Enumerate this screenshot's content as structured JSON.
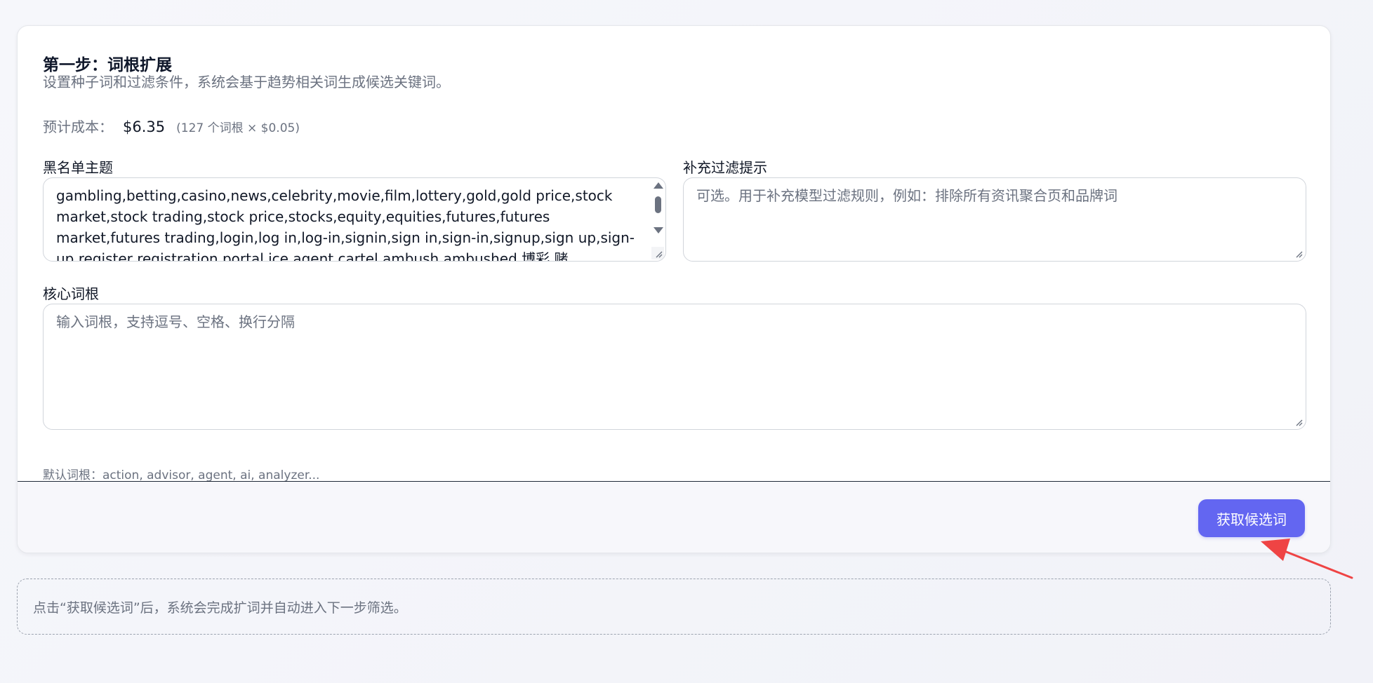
{
  "step": {
    "title": "第一步：词根扩展",
    "description": "设置种子词和过滤条件，系统会基于趋势相关词生成候选关键词。"
  },
  "cost": {
    "label": "预计成本：",
    "value": "$6.35",
    "note": "(127 个词根 × $0.05)"
  },
  "blacklist": {
    "label": "黑名单主题",
    "value": "gambling,betting,casino,news,celebrity,movie,film,lottery,gold,gold price,stock market,stock trading,stock price,stocks,equity,equities,futures,futures market,futures trading,login,log in,log-in,signin,sign in,sign-in,signup,sign up,sign-up,register,registration,portal,ice agent,cartel,ambush,ambushed,博彩,赌"
  },
  "filter_hint": {
    "label": "补充过滤提示",
    "placeholder": "可选。用于补充模型过滤规则，例如：排除所有资讯聚合页和品牌词"
  },
  "core_roots": {
    "label": "核心词根",
    "placeholder": "输入词根，支持逗号、空格、换行分隔",
    "default_hint": "默认词根：action, advisor, agent, ai, analyzer..."
  },
  "footer": {
    "primary_label": "获取候选词"
  },
  "notice": {
    "text": "点击“获取候选词”后，系统会完成扩词并自动进入下一步筛选。"
  },
  "colors": {
    "accent": "#6366f1",
    "annotation_arrow": "#ef4444"
  },
  "icons": {
    "annotation": "red-arrow-icon",
    "resize": "resize-grip-icon"
  }
}
